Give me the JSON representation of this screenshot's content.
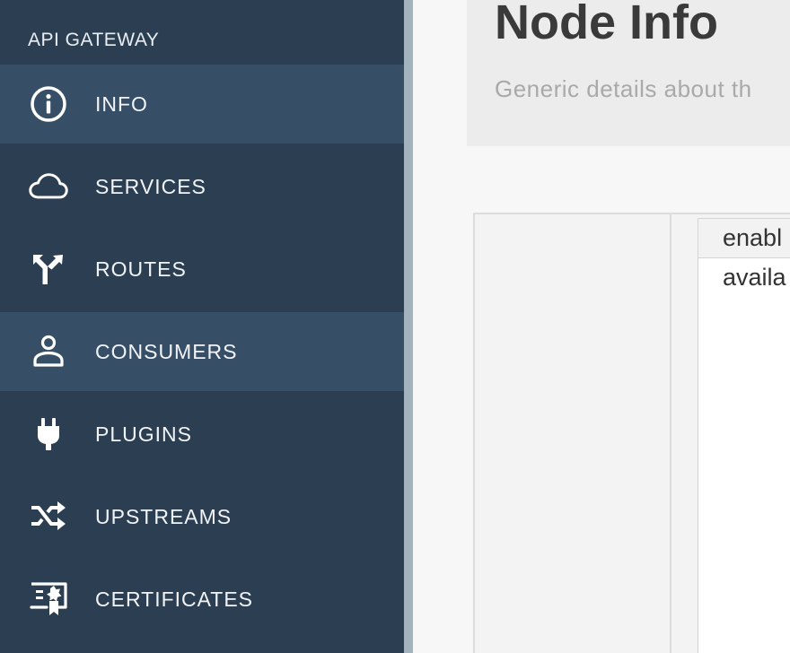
{
  "sidebar": {
    "brand": "API GATEWAY",
    "items": [
      {
        "label": "INFO",
        "icon": "info-icon",
        "active": true
      },
      {
        "label": "SERVICES",
        "icon": "cloud-icon",
        "active": false
      },
      {
        "label": "ROUTES",
        "icon": "route-fork-icon",
        "active": false
      },
      {
        "label": "CONSUMERS",
        "icon": "user-icon",
        "active": true
      },
      {
        "label": "PLUGINS",
        "icon": "plug-icon",
        "active": false
      },
      {
        "label": "UPSTREAMS",
        "icon": "shuffle-icon",
        "active": false
      },
      {
        "label": "CERTIFICATES",
        "icon": "certificate-icon",
        "active": false
      }
    ]
  },
  "header": {
    "title": "Node Info",
    "subtitle": "Generic details about th"
  },
  "table": {
    "header_cell": "enabl",
    "rows": [
      "availa"
    ]
  },
  "colors": {
    "sidebar_bg": "#2c3e52",
    "sidebar_active": "#364e66",
    "sidebar_border": "#a3b3be",
    "header_bg": "#ececec"
  }
}
